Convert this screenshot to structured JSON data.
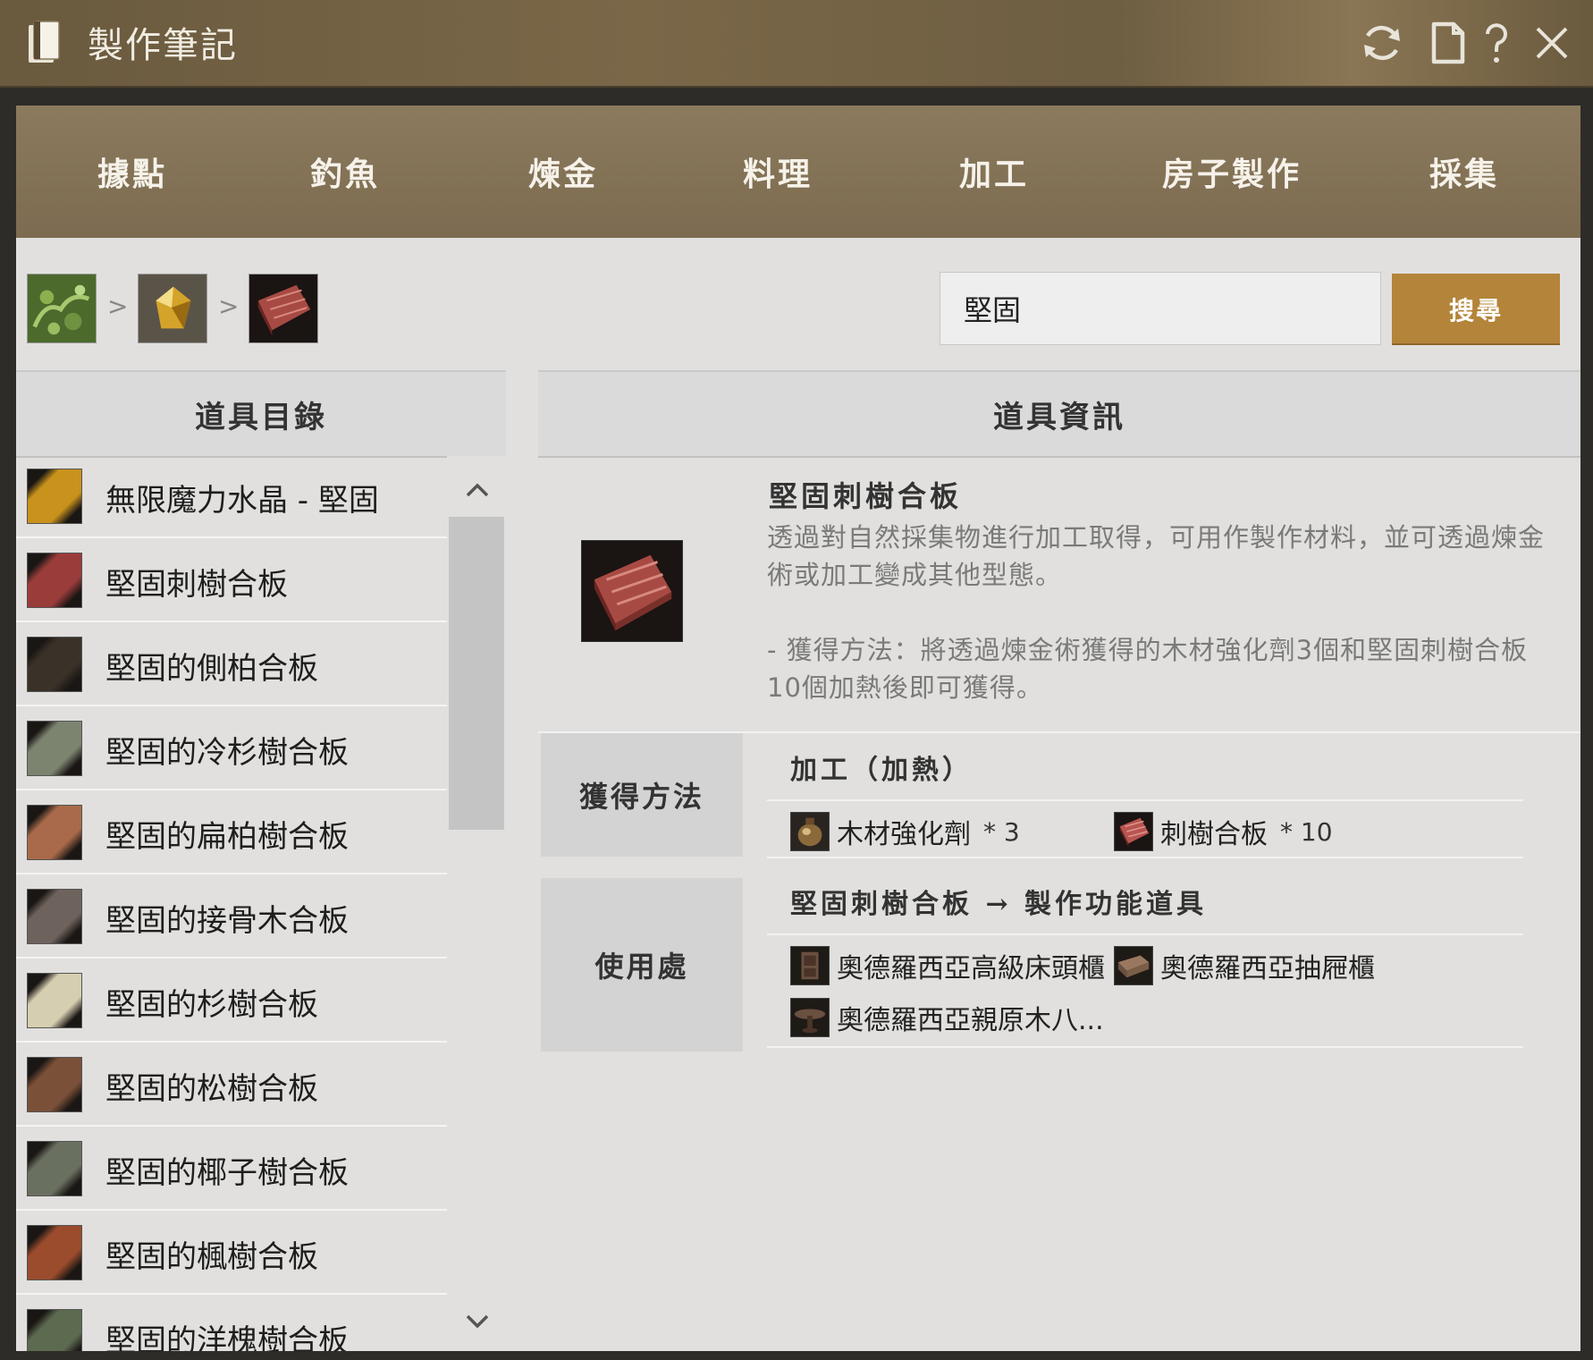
{
  "window": {
    "title": "製作筆記",
    "controls": [
      "refresh-icon",
      "page-icon",
      "help-icon",
      "close-icon"
    ]
  },
  "tabs": [
    "據點",
    "釣魚",
    "煉金",
    "料理",
    "加工",
    "房子製作",
    "採集"
  ],
  "breadcrumb": {
    "separator": ">",
    "items": [
      "plant-icon",
      "crystal-icon",
      "plywood-icon"
    ]
  },
  "search": {
    "value": "堅固",
    "button": "搜尋"
  },
  "catalog": {
    "header": "道具目錄",
    "items": [
      {
        "label": "無限魔力水晶 - 堅固",
        "color": "#c8921c"
      },
      {
        "label": "堅固刺樹合板",
        "color": "#9a3c3a"
      },
      {
        "label": "堅固的側柏合板",
        "color": "#3a3128"
      },
      {
        "label": "堅固的冷杉樹合板",
        "color": "#7c8470"
      },
      {
        "label": "堅固的扁柏樹合板",
        "color": "#a86a4a"
      },
      {
        "label": "堅固的接骨木合板",
        "color": "#6e625c"
      },
      {
        "label": "堅固的杉樹合板",
        "color": "#d6ceb0"
      },
      {
        "label": "堅固的松樹合板",
        "color": "#7a5038"
      },
      {
        "label": "堅固的椰子樹合板",
        "color": "#6a7060"
      },
      {
        "label": "堅固的楓樹合板",
        "color": "#9a4c2c"
      },
      {
        "label": "堅固的洋槐樹合板",
        "color": "#5c6a50"
      }
    ]
  },
  "info": {
    "header": "道具資訊",
    "name": "堅固刺樹合板",
    "description": "透過對自然採集物進行加工取得，可用作製作材料，並可透過煉金術或加工變成其他型態。",
    "obtain_note": "- 獲得方法：將透過煉金術獲得的木材強化劑3個和堅固刺樹合板10個加熱後即可獲得。",
    "obtain": {
      "label": "獲得方法",
      "method": "加工（加熱）",
      "materials": [
        {
          "name": "木材強化劑",
          "qty": "* 3",
          "icon": "reinforcement-agent-icon"
        },
        {
          "name": "刺樹合板",
          "qty": "* 10",
          "icon": "plywood-icon"
        }
      ]
    },
    "usage": {
      "label": "使用處",
      "title": "堅固刺樹合板 → 製作功能道具",
      "items": [
        {
          "name": "奧德羅西亞高級床頭櫃",
          "icon": "nightstand-icon"
        },
        {
          "name": "奧德羅西亞抽屜櫃",
          "icon": "drawer-icon"
        },
        {
          "name": "奧德羅西亞親原木八...",
          "icon": "table-icon"
        }
      ]
    }
  },
  "colors": {
    "accent": "#b4843a",
    "tab_bar": "#7c6b50",
    "panel_bg": "#e1e0de"
  }
}
